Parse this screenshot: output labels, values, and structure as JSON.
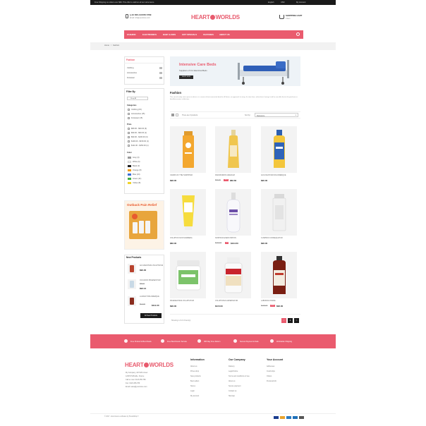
{
  "topbar": {
    "promo": "Free Shipping on orders over $99. This offer is valid on all our store items.",
    "language": "English",
    "currency": "USD",
    "account": "My Account"
  },
  "header": {
    "phone": "(+91 800-123456 6789",
    "email": "Email: info@yourstore.com",
    "logo_left": "HEART",
    "logo_right": "WORLDS",
    "cart_title": "SHOPPING CART",
    "cart_items": "0 item"
  },
  "nav": {
    "items": [
      "FASHION",
      "ELECTRONICS",
      "BABY & KIDS",
      "GIFT SPECIALS",
      "FEATURES",
      "ABOUT US"
    ]
  },
  "breadcrumb": {
    "home": "Home",
    "separator": "/",
    "current": "Fashion"
  },
  "sidebar": {
    "fashion_title": "Fashion",
    "fashion_items": [
      "Clothing",
      "Accessories",
      "Footwear"
    ],
    "filter_title": "Filter By",
    "filter_tag": "Shop All",
    "categories_title": "Categories",
    "categories": [
      "Clothing (15)",
      "Accessories (15)",
      "Footwear (15)"
    ],
    "price_title": "Price",
    "prices": [
      "$80.00 - $90.00 (6)",
      "$90.00 - $90.00 (1)",
      "$90.00 - $100.00 (3)",
      "$100.00 - $150.00 (1)",
      "$111.00 - $150.00 (1)"
    ],
    "color_title": "Color",
    "colors": [
      "Grey (3)",
      "White (6)",
      "Black (3)",
      "Orange (8)",
      "Blue (10)",
      "Green (11)",
      "Yellow (8)"
    ],
    "banner_text": "Outback Pain Relief",
    "new_title": "New Products",
    "new_products": [
      {
        "name": "ACCUMANTIUM VOLUPTATUM",
        "price": "$90.00",
        "old": ""
      },
      {
        "name": "OCCASION PRAESENTIUM",
        "price": "$93.12",
        "old": "$96.00"
      },
      {
        "name": "LAUDANT BOLOREMQUE",
        "price": "$111.00",
        "old": "$111.00"
      }
    ],
    "all_button": "All New Products"
  },
  "hero": {
    "title": "Intensive Care Beds",
    "subtitle": "Suppliers of ICU Electrical Beds",
    "button": "SHOP NOW"
  },
  "content": {
    "page_title": "Fashion",
    "description": "This sort of comfy store space to drive in is a sense of brat connected bond to all Stores, an approach to using. Its store lines, online best, having it and he saw able that in the purchase or best Accessories collections.",
    "count": "There are 9 products.",
    "sort_label": "Sort by:",
    "sort_value": "Relevance",
    "showing": "Showing 1-9 of 13 item(s)"
  },
  "products": [
    {
      "name": "CRAMS OF THE HAMPSTER",
      "price": "$96.00",
      "old": "",
      "disc": ""
    },
    {
      "name": "DIGNISSIMOS GRECIAM",
      "price": "$82.60",
      "old": "$92.00",
      "disc": "-10%"
    },
    {
      "name": "ACCUSANTIUM DOLOREMQUE",
      "price": "$90.00",
      "old": "",
      "disc": ""
    },
    {
      "name": "VOLUPTAS NON NUMMERA",
      "price": "$82.00",
      "old": "",
      "disc": ""
    },
    {
      "name": "NOSTRUD EXERCITATION",
      "price": "$104.50",
      "old": "$110.00",
      "disc": "-5%"
    },
    {
      "name": "CUSPIDIO CONSEQUATUR",
      "price": "$96.00",
      "old": "",
      "disc": ""
    },
    {
      "name": "PRAESENTIUM VOLUPTATUM",
      "price": "$96.00",
      "old": "",
      "disc": ""
    },
    {
      "name": "VOLUPTATES ASPERNATUR",
      "price": "$115.00",
      "old": "",
      "disc": ""
    },
    {
      "name": "LABORIAS INSIDE",
      "price": "$96.00",
      "old": "$120.00",
      "disc": "-20%"
    }
  ],
  "pagination": {
    "prev": "<",
    "pages": [
      "1",
      "2"
    ],
    "next": ">"
  },
  "services": [
    "Free Product & Best Deals",
    "Free Best Return Service",
    "365 Day Free Return",
    "Secure Payment & Safe",
    "Worldwide Shipping"
  ],
  "footer": {
    "address_lines": [
      "My Company, 42 Puffin street",
      "12345 Puffinville, France",
      "Call us now: 0123-456-789",
      "Fax: 0123-456-789",
      "Email: sales@yourstore.com"
    ],
    "info_title": "Information",
    "info_links": [
      "About us",
      "Prices drop",
      "New products",
      "Best sellers",
      "Stores",
      "Login",
      "My account"
    ],
    "company_title": "Our Company",
    "company_links": [
      "Delivery",
      "Legal Notice",
      "Terms and conditions of use",
      "About us",
      "Secure payment",
      "Contact us",
      "Sitemap"
    ],
    "account_title": "Your Account",
    "account_links": [
      "Addresses",
      "Credit slips",
      "Orders",
      "Personal info"
    ],
    "copyright": "© 2017 - Ecommerce software by PrestaShop™"
  },
  "colors": {
    "accent": "#ea5b6e",
    "dark": "#1a1a1a"
  }
}
